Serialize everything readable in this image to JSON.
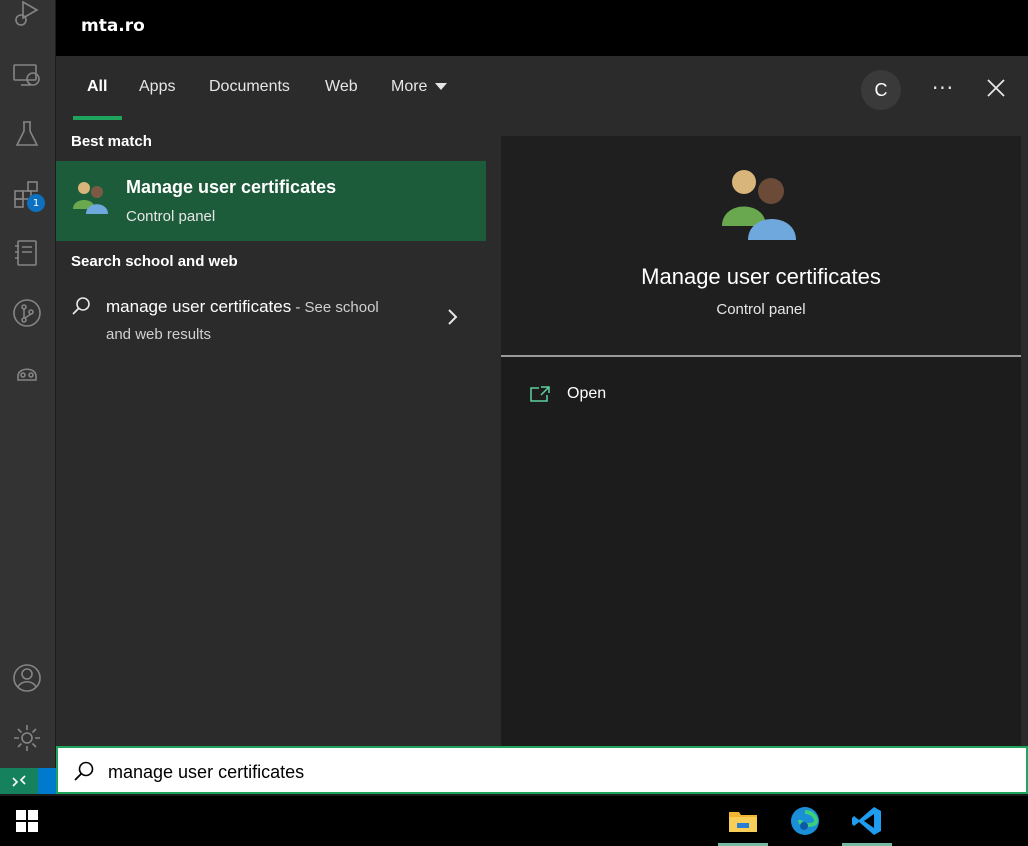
{
  "window": {
    "title": "mta.ro"
  },
  "tabs": [
    {
      "label": "All",
      "active": true
    },
    {
      "label": "Apps"
    },
    {
      "label": "Documents"
    },
    {
      "label": "Web"
    },
    {
      "label": "More"
    }
  ],
  "header_actions": {
    "account_initial": "C",
    "more_options": "···"
  },
  "results": {
    "best_match_heading": "Best match",
    "best_match": {
      "name": "Manage user certificates",
      "type": "Control panel"
    },
    "web_heading": "Search school and web",
    "web_result": {
      "query": "manage user certificates",
      "suffix": " - See school",
      "suffix_line2": "and web results"
    }
  },
  "preview": {
    "name": "Manage user certificates",
    "type": "Control panel",
    "actions": [
      {
        "label": "Open"
      }
    ]
  },
  "search": {
    "value": "manage user certificates"
  },
  "activity_bar": {
    "extensions_badge": "1"
  },
  "taskbar": {
    "apps": [
      "file-explorer",
      "edge",
      "vscode"
    ]
  },
  "colors": {
    "accent_green": "#1ea45d",
    "selected_bg": "#1d5c3a",
    "badge_blue": "#0e70c0"
  }
}
